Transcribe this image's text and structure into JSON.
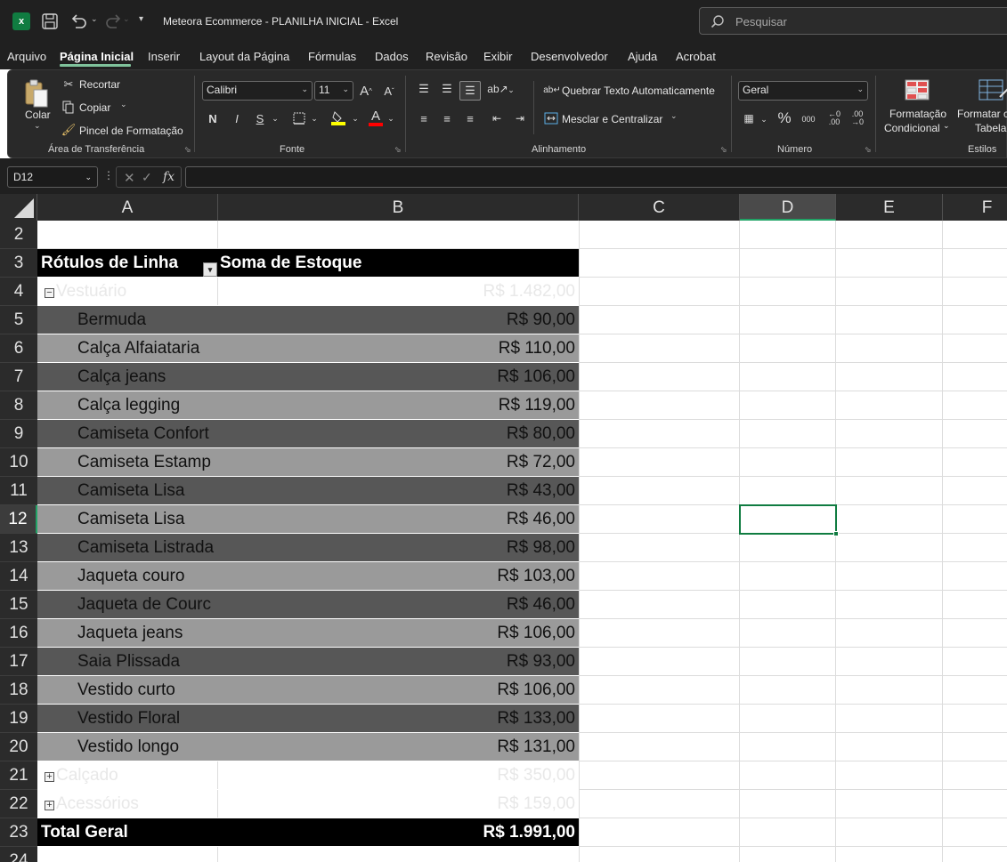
{
  "titlebar": {
    "app_icon_letter": "x",
    "document_title": "Meteora Ecommerce - PLANILHA INICIAL  -  Excel",
    "search_placeholder": "Pesquisar"
  },
  "menu": {
    "items": [
      "Arquivo",
      "Página Inicial",
      "Inserir",
      "Layout da Página",
      "Fórmulas",
      "Dados",
      "Revisão",
      "Exibir",
      "Desenvolvedor",
      "Ajuda",
      "Acrobat"
    ],
    "active": "Página Inicial"
  },
  "ribbon": {
    "clipboard": {
      "paste": "Colar",
      "cut": "Recortar",
      "copy": "Copiar",
      "format_painter": "Pincel de Formatação",
      "group_label": "Área de Transferência"
    },
    "font": {
      "name": "Calibri",
      "size": "11",
      "bold": "N",
      "italic": "I",
      "underline": "S",
      "grow": "A",
      "shrink": "A",
      "font_color_letter": "A",
      "group_label": "Fonte"
    },
    "alignment": {
      "wrap_text": "Quebrar Texto Automaticamente",
      "merge_center": "Mesclar e Centralizar",
      "group_label": "Alinhamento"
    },
    "number": {
      "format": "Geral",
      "percent": "%",
      "thousands": "000",
      "group_label": "Número"
    },
    "styles": {
      "conditional_formatting_line1": "Formatação",
      "conditional_formatting_line2": "Condicional",
      "format_as_table_line1": "Formatar c",
      "format_as_table_line2": "Tabela",
      "group_label": "Estilos"
    }
  },
  "formula_bar": {
    "name_box": "D12",
    "fx": "fx",
    "value": ""
  },
  "grid": {
    "columns": [
      "A",
      "B",
      "C",
      "D",
      "E",
      "F"
    ],
    "selected_column": "D",
    "selected_row": "12",
    "selected_cell": "D12"
  },
  "pivot": {
    "header_rows_label": "Rótulos de Linha",
    "header_values_label": "Soma de Estoque",
    "rows": [
      {
        "row": "2",
        "type": "blank",
        "label": "",
        "value": ""
      },
      {
        "row": "4",
        "type": "group",
        "toggle": "−",
        "label": "Vestuário",
        "value": "R$ 1.482,00"
      },
      {
        "row": "5",
        "type": "dark",
        "label": "Bermuda",
        "value": "R$ 90,00"
      },
      {
        "row": "6",
        "type": "light",
        "label": "Calça Alfaiataria",
        "value": "R$ 110,00"
      },
      {
        "row": "7",
        "type": "dark",
        "label": "Calça jeans",
        "value": "R$ 106,00"
      },
      {
        "row": "8",
        "type": "light",
        "label": "Calça legging",
        "value": "R$ 119,00"
      },
      {
        "row": "9",
        "type": "dark",
        "label": "Camiseta Confort",
        "value": "R$ 80,00"
      },
      {
        "row": "10",
        "type": "light",
        "label": "Camiseta Estamp",
        "value": "R$ 72,00"
      },
      {
        "row": "11",
        "type": "dark",
        "label": "Camiseta Lisa",
        "value": "R$ 43,00"
      },
      {
        "row": "12",
        "type": "light",
        "label": "Camiseta Lisa",
        "value": "R$ 46,00"
      },
      {
        "row": "13",
        "type": "dark",
        "label": "Camiseta Listrada",
        "value": "R$ 98,00"
      },
      {
        "row": "14",
        "type": "light",
        "label": "Jaqueta couro",
        "value": "R$ 103,00"
      },
      {
        "row": "15",
        "type": "dark",
        "label": "Jaqueta de Courc",
        "value": "R$ 46,00"
      },
      {
        "row": "16",
        "type": "light",
        "label": "Jaqueta jeans",
        "value": "R$ 106,00"
      },
      {
        "row": "17",
        "type": "dark",
        "label": "Saia Plissada",
        "value": "R$ 93,00"
      },
      {
        "row": "18",
        "type": "light",
        "label": "Vestido curto",
        "value": "R$ 106,00"
      },
      {
        "row": "19",
        "type": "dark",
        "label": "Vestido Floral",
        "value": "R$ 133,00"
      },
      {
        "row": "20",
        "type": "light",
        "label": "Vestido longo",
        "value": "R$ 131,00"
      },
      {
        "row": "21",
        "type": "group",
        "toggle": "+",
        "label": "Calçado",
        "value": "R$ 350,00"
      },
      {
        "row": "22",
        "type": "group",
        "toggle": "+",
        "label": "Acessórios",
        "value": "R$ 159,00"
      },
      {
        "row": "23",
        "type": "total",
        "label": "Total Geral",
        "value": "R$ 1.991,00"
      }
    ],
    "extra_row": "24"
  }
}
